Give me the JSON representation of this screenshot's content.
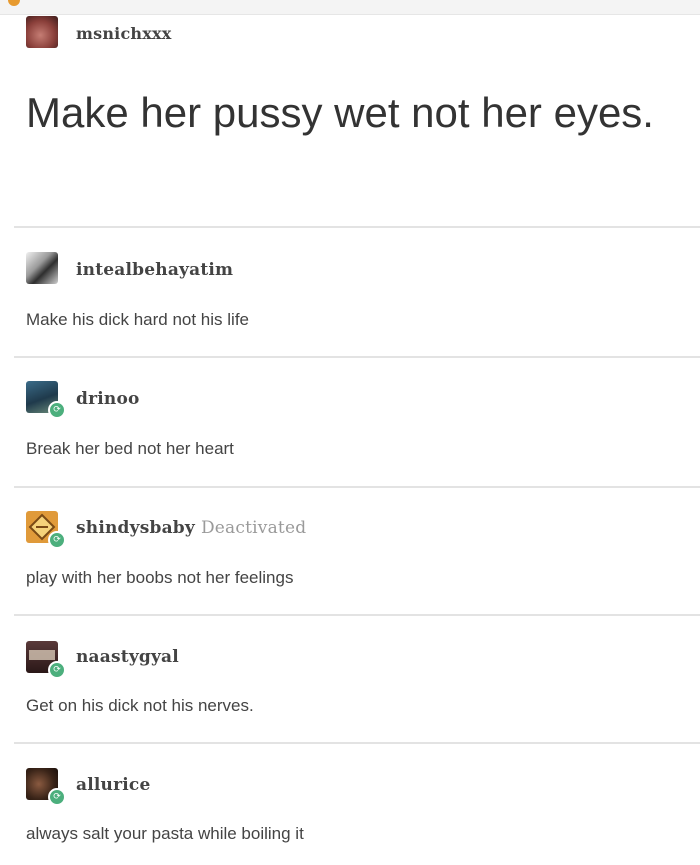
{
  "posts": [
    {
      "username": "msnichxxx",
      "text": "Make her pussy wet not her eyes.",
      "avatar_color": "#a35b55"
    },
    {
      "username": "intealbehayatim",
      "text": "Make his dick hard not his life",
      "avatar_color": "#6f6f6f"
    },
    {
      "username": "drinoo",
      "text": "Break her bed not her heart",
      "avatar_color": "#2d5570"
    },
    {
      "username": "shindysbaby",
      "status": "Deactivated",
      "text": "play with her boobs not her feelings",
      "avatar_color": "#d98a2b"
    },
    {
      "username": "naastygyal",
      "text": "Get on his dick not his nerves.",
      "avatar_color": "#4a2d2d"
    },
    {
      "username": "allurice",
      "text": "always salt your pasta while boiling it",
      "avatar_color": "#5a3a28"
    }
  ],
  "colors": {
    "reblog_badge": "#4caf7d",
    "divider": "#e3e3e3"
  }
}
